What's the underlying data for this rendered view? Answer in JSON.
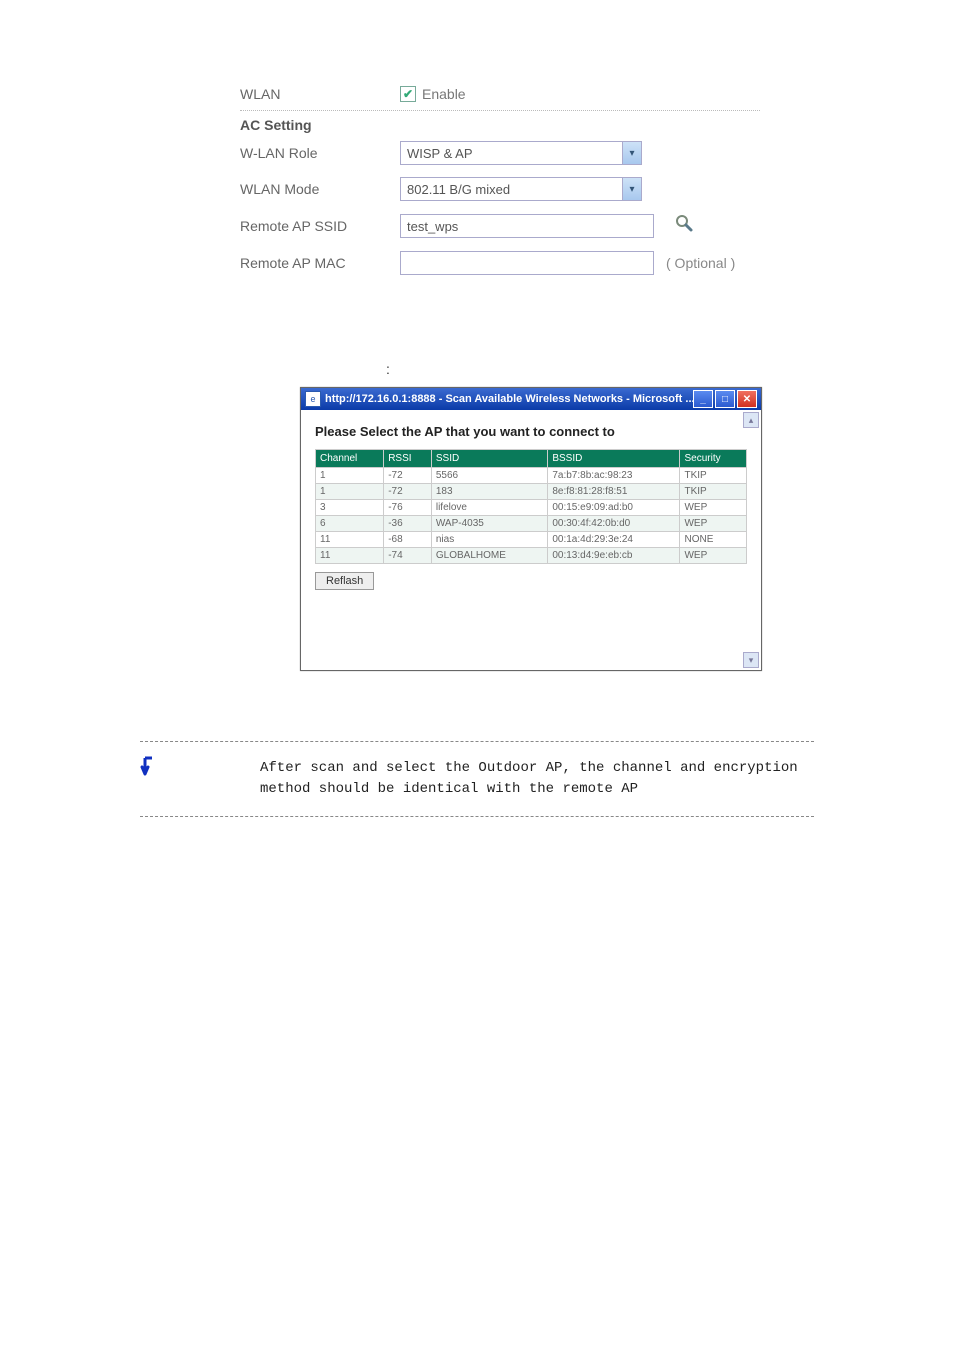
{
  "settings": {
    "wlan_label": "WLAN",
    "enable_label": "Enable",
    "ac_setting_label": "AC Setting",
    "wlan_role_label": "W-LAN Role",
    "wlan_role_value": "WISP & AP",
    "wlan_mode_label": "WLAN Mode",
    "wlan_mode_value": "802.11 B/G mixed",
    "remote_ap_ssid_label": "Remote AP SSID",
    "remote_ap_ssid_value": "test_wps",
    "remote_ap_mac_label": "Remote AP MAC",
    "remote_ap_mac_value": "",
    "optional_text": "( Optional )"
  },
  "colon_text": ":",
  "dialog": {
    "title": "http://172.16.0.1:8888 - Scan Available Wireless Networks - Microsoft ...",
    "heading": "Please Select the AP that you want to connect to",
    "headers": {
      "channel": "Channel",
      "rssi": "RSSI",
      "ssid": "SSID",
      "bssid": "BSSID",
      "security": "Security"
    },
    "rows": [
      {
        "channel": "1",
        "rssi": "-72",
        "ssid": "5566",
        "bssid": "7a:b7:8b:ac:98:23",
        "security": "TKIP"
      },
      {
        "channel": "1",
        "rssi": "-72",
        "ssid": "183",
        "bssid": "8e:f8:81:28:f8:51",
        "security": "TKIP"
      },
      {
        "channel": "3",
        "rssi": "-76",
        "ssid": "lifelove",
        "bssid": "00:15:e9:09:ad:b0",
        "security": "WEP"
      },
      {
        "channel": "6",
        "rssi": "-36",
        "ssid": "WAP-4035",
        "bssid": "00:30:4f:42:0b:d0",
        "security": "WEP"
      },
      {
        "channel": "11",
        "rssi": "-68",
        "ssid": "nias",
        "bssid": "00:1a:4d:29:3e:24",
        "security": "NONE"
      },
      {
        "channel": "11",
        "rssi": "-74",
        "ssid": "GLOBALHOME",
        "bssid": "00:13:d4:9e:eb:cb",
        "security": "WEP"
      }
    ],
    "reflash_label": "Reflash"
  },
  "note": {
    "text": "After scan and select the Outdoor AP, the channel and encryption method should be identical with the remote AP"
  }
}
